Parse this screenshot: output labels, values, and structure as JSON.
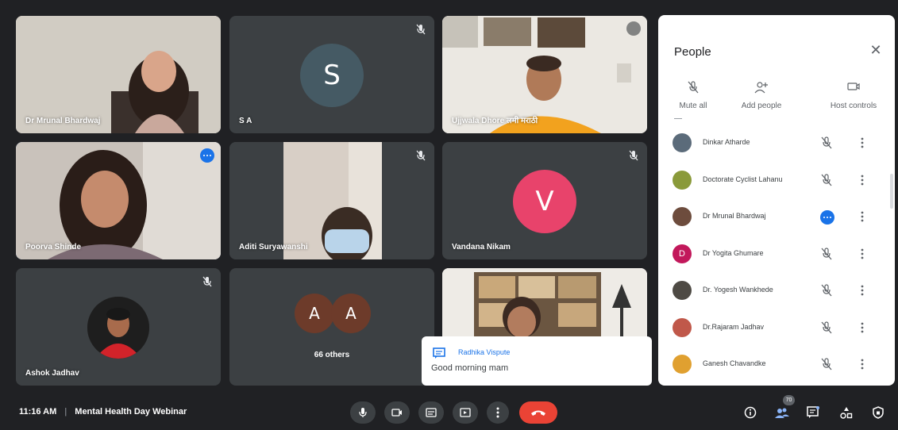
{
  "meeting": {
    "time": "11:16 AM",
    "separator": "|",
    "title": "Mental Health Day Webinar"
  },
  "tiles": [
    {
      "name": "Dr Mrunal Bhardwaj",
      "type": "video"
    },
    {
      "name": "S A",
      "type": "avatar",
      "initial": "S",
      "avatar_color": "#455a64",
      "muted": true
    },
    {
      "name": "Ujjwala Dhore लमी मराठी",
      "type": "video"
    },
    {
      "name": "Poorva Shinde",
      "type": "video",
      "active_speaker": true
    },
    {
      "name": "Aditi Suryawanshi",
      "type": "video",
      "muted": true
    },
    {
      "name": "Vandana Nikam",
      "type": "avatar",
      "initial": "V",
      "avatar_color": "#e8436b",
      "muted": true
    },
    {
      "name": "Ashok Jadhav",
      "type": "photo-avatar",
      "muted": true
    },
    {
      "name": "66 others",
      "type": "others",
      "initials": [
        "A",
        "A"
      ]
    },
    {
      "name": "",
      "type": "video"
    }
  ],
  "toast": {
    "sender": "Radhika Vispute",
    "message": "Good morning mam"
  },
  "people_panel": {
    "title": "People",
    "actions": [
      {
        "label": "Mute all",
        "icon": "mic-off-icon"
      },
      {
        "label": "Add people",
        "icon": "add-person-icon"
      },
      {
        "label": "Host controls",
        "icon": "host-controls-icon"
      }
    ],
    "participants": [
      {
        "name": "Dinkar Atharde",
        "avatar_color": "#5b6b7a",
        "status": "muted"
      },
      {
        "name": "Doctorate Cyclist Lahanu",
        "avatar_color": "#8a9a3a",
        "status": "muted"
      },
      {
        "name": "Dr Mrunal Bhardwaj",
        "avatar_color": "#6d4c3d",
        "status": "speaking"
      },
      {
        "name": "Dr Yogita Ghumare",
        "initial": "D",
        "avatar_color": "#c2185b",
        "status": "muted"
      },
      {
        "name": "Dr. Yogesh Wankhede",
        "avatar_color": "#4e4a44",
        "status": "muted"
      },
      {
        "name": "Dr.Rajaram Jadhav",
        "avatar_color": "#c0584a",
        "status": "muted"
      },
      {
        "name": "Ganesh Chavandke",
        "avatar_color": "#e0a030",
        "status": "muted"
      }
    ]
  },
  "toolbar": {
    "buttons": [
      "mic-icon",
      "camera-icon",
      "captions-icon",
      "present-icon",
      "more-icon",
      "end-call-icon"
    ],
    "participant_count": "70"
  },
  "colors": {
    "background": "#202124",
    "tile": "#3c4043",
    "accent_blue": "#1a73e8",
    "end_call_red": "#ea4335",
    "active_speaker_border": "#8ab4f8"
  }
}
